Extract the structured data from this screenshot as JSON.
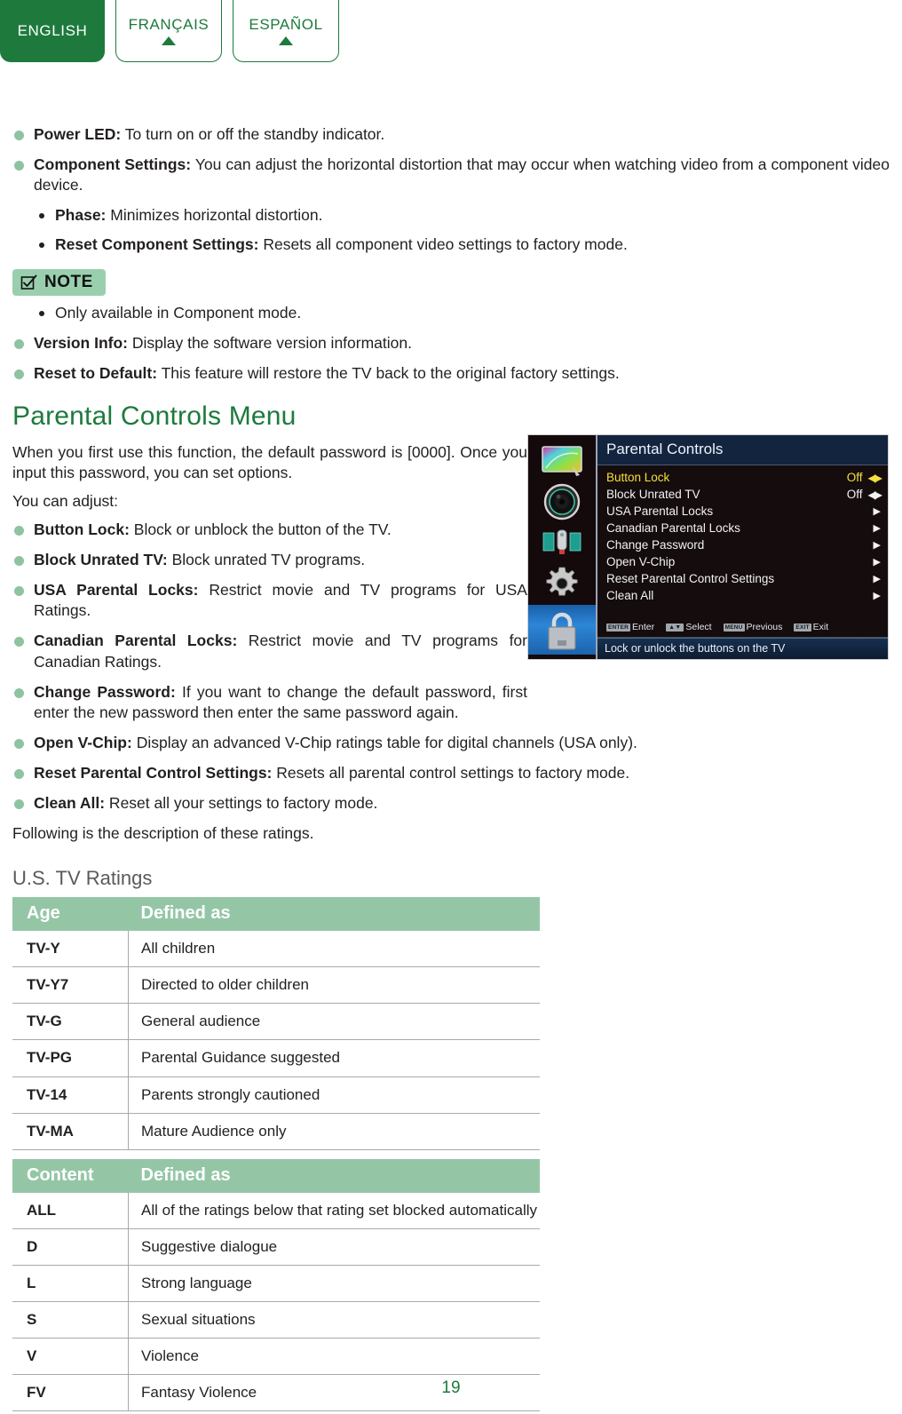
{
  "lang_tabs": [
    {
      "label": "ENGLISH",
      "active": true
    },
    {
      "label": "FRANÇAIS",
      "active": false
    },
    {
      "label": "ESPAÑOL",
      "active": false
    }
  ],
  "top_section": {
    "bullets": [
      {
        "term": "Power LED:",
        "desc": " To turn on or off the standby indicator."
      },
      {
        "term": "Component Settings:",
        "desc": " You can adjust the horizontal distortion that may occur when watching video from a component video device."
      }
    ],
    "sub_bullets": [
      {
        "term": "Phase:",
        "desc": " Minimizes horizontal distortion."
      },
      {
        "term": "Reset Component Settings:",
        "desc": " Resets all component video settings to factory mode."
      }
    ],
    "note": {
      "label": "NOTE",
      "icon": "checkbox-pencil-icon",
      "items": [
        "Only available in Component mode."
      ]
    },
    "bullets_after_note": [
      {
        "term": "Version Info:",
        "desc": " Display the software version information."
      },
      {
        "term": "Reset to Default:",
        "desc": " This feature will restore the TV back to the original factory settings."
      }
    ]
  },
  "parental": {
    "heading": "Parental Controls Menu",
    "intro": "When you first use this function, the default password is [0000]. Once you input this password, you can set options.",
    "intro2": "You can adjust:",
    "bullets_left": [
      {
        "term": "Button Lock:",
        "desc": " Block or unblock the button of the TV."
      },
      {
        "term": "Block Unrated TV:",
        "desc": " Block unrated TV programs."
      },
      {
        "term": "USA Parental Locks:",
        "desc": " Restrict movie and TV programs for USA Ratings."
      },
      {
        "term": "Canadian Parental Locks:",
        "desc": " Restrict movie and TV programs for Canadian Ratings."
      },
      {
        "term": "Change Password:",
        "desc": " If you want to change the default password, first enter the new password then enter the same password again."
      }
    ],
    "bullets_full": [
      {
        "term": "Open V-Chip:",
        "desc": " Display an advanced V-Chip ratings table for digital channels (USA only)."
      },
      {
        "term": "Reset Parental Control Settings:",
        "desc": " Resets all parental control settings to factory mode."
      },
      {
        "term": "Clean All:",
        "desc": " Reset all your settings to factory mode."
      }
    ],
    "closing": "Following is the description of these ratings."
  },
  "osd": {
    "title": "Parental Controls",
    "sidebar_icons": [
      {
        "name": "picture-icon",
        "selected": false
      },
      {
        "name": "sound-speaker-icon",
        "selected": false
      },
      {
        "name": "channel-satellite-icon",
        "selected": false
      },
      {
        "name": "settings-gear-icon",
        "selected": false
      },
      {
        "name": "lock-padlock-icon",
        "selected": true
      }
    ],
    "menu_items": [
      {
        "label": "Button Lock",
        "value": "Off",
        "arrow": "leftright",
        "highlighted": true
      },
      {
        "label": "Block Unrated TV",
        "value": "Off",
        "arrow": "leftright",
        "highlighted": false
      },
      {
        "label": "USA Parental Locks",
        "value": "",
        "arrow": "right",
        "highlighted": false
      },
      {
        "label": "Canadian Parental Locks",
        "value": "",
        "arrow": "right",
        "highlighted": false
      },
      {
        "label": "Change Password",
        "value": "",
        "arrow": "right",
        "highlighted": false
      },
      {
        "label": "Open V-Chip",
        "value": "",
        "arrow": "right",
        "highlighted": false
      },
      {
        "label": "Reset Parental Control Settings",
        "value": "",
        "arrow": "right",
        "highlighted": false
      },
      {
        "label": "Clean All",
        "value": "",
        "arrow": "right",
        "highlighted": false
      }
    ],
    "key_hints": [
      {
        "key": "ENTER",
        "label": "Enter"
      },
      {
        "key": "▲▼",
        "label": "Select"
      },
      {
        "key": "MENU",
        "label": "Previous"
      },
      {
        "key": "EXIT",
        "label": "Exit"
      }
    ],
    "status_text": "Lock or unlock the buttons on the TV"
  },
  "ratings": {
    "section_title": "U.S. TV Ratings",
    "age_table": {
      "headers": [
        "Age",
        "Defined as"
      ],
      "rows": [
        [
          "TV-Y",
          "All children"
        ],
        [
          "TV-Y7",
          "Directed to older children"
        ],
        [
          "TV-G",
          "General audience"
        ],
        [
          "TV-PG",
          "Parental Guidance suggested"
        ],
        [
          "TV-14",
          "Parents strongly cautioned"
        ],
        [
          "TV-MA",
          "Mature Audience only"
        ]
      ]
    },
    "content_table": {
      "headers": [
        "Content",
        "Defined as"
      ],
      "rows": [
        [
          "ALL",
          "All of the ratings below that rating set blocked automatically"
        ],
        [
          "D",
          "Suggestive dialogue"
        ],
        [
          "L",
          "Strong language"
        ],
        [
          "S",
          "Sexual situations"
        ],
        [
          "V",
          "Violence"
        ],
        [
          "FV",
          "Fantasy Violence"
        ]
      ]
    }
  },
  "page_number": "19",
  "colors": {
    "brand_green": "#1d7a3c",
    "table_header_green": "#94c6a6",
    "bullet_green": "#8dc49f",
    "note_green": "#9acfae",
    "osd_title_navy": "#13243f",
    "osd_highlight_yellow": "#f5e03c"
  }
}
